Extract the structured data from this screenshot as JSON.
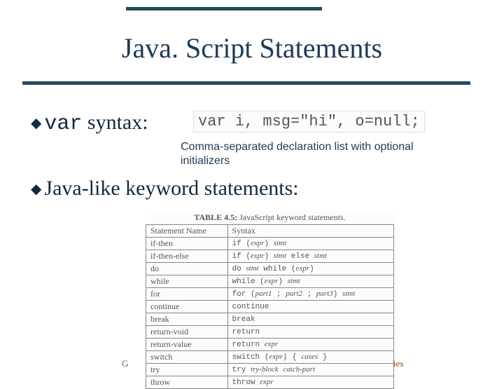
{
  "title": "Java. Script Statements",
  "bullets": {
    "var_code": "var",
    "var_rest": " syntax:",
    "java_like": "Java-like keyword statements:"
  },
  "var_example": "var i, msg=\"hi\", o=null;",
  "note": "Comma-separated declaration list with optional initializers",
  "table": {
    "caption_label": "TABLE 4.5:",
    "caption_text": " JavaScript keyword statements.",
    "header": {
      "col1": "Statement Name",
      "col2": "Syntax"
    },
    "rows": [
      {
        "name": "if-then",
        "syntax_plain": "if (",
        "syntax_it1": "expr",
        "syntax_mid": ") ",
        "syntax_it2": "stmt",
        "syntax_end": ""
      },
      {
        "name": "if-then-else",
        "syntax_plain": "if (",
        "syntax_it1": "expr",
        "syntax_mid": ") ",
        "syntax_it2": "stmt",
        "syntax_end": " else ",
        "syntax_it3": "stmt"
      },
      {
        "name": "do",
        "syntax_plain": "do ",
        "syntax_it1": "stmt",
        "syntax_mid": " while (",
        "syntax_it2": "expr",
        "syntax_end": ")"
      },
      {
        "name": "while",
        "syntax_plain": "while (",
        "syntax_it1": "expr",
        "syntax_mid": ") ",
        "syntax_it2": "stmt",
        "syntax_end": ""
      },
      {
        "name": "for",
        "syntax_plain": "for (",
        "syntax_it1": "part1",
        "syntax_mid": " ; ",
        "syntax_it2": "part2",
        "syntax_end": " ; ",
        "syntax_it3": "part3",
        "syntax_post": ") ",
        "syntax_it4": "stmt"
      },
      {
        "name": "continue",
        "syntax_plain": "continue",
        "syntax_it1": "",
        "syntax_mid": "",
        "syntax_it2": "",
        "syntax_end": ""
      },
      {
        "name": "break",
        "syntax_plain": "break",
        "syntax_it1": "",
        "syntax_mid": "",
        "syntax_it2": "",
        "syntax_end": ""
      },
      {
        "name": "return-void",
        "syntax_plain": "return",
        "syntax_it1": "",
        "syntax_mid": "",
        "syntax_it2": "",
        "syntax_end": ""
      },
      {
        "name": "return-value",
        "syntax_plain": "return ",
        "syntax_it1": "expr",
        "syntax_mid": "",
        "syntax_it2": "",
        "syntax_end": ""
      },
      {
        "name": "switch",
        "syntax_plain": "switch (",
        "syntax_it1": "expr",
        "syntax_mid": ") { ",
        "syntax_it2": "cases",
        "syntax_end": " }"
      },
      {
        "name": "try",
        "syntax_plain": "try ",
        "syntax_it1": "try-block",
        "syntax_mid": " ",
        "syntax_it2": "catch-part",
        "syntax_end": ""
      },
      {
        "name": "throw",
        "syntax_plain": "throw ",
        "syntax_it1": "expr",
        "syntax_mid": "",
        "syntax_it2": "",
        "syntax_end": ""
      }
    ]
  },
  "footer": {
    "left": "G",
    "right": "ies"
  }
}
